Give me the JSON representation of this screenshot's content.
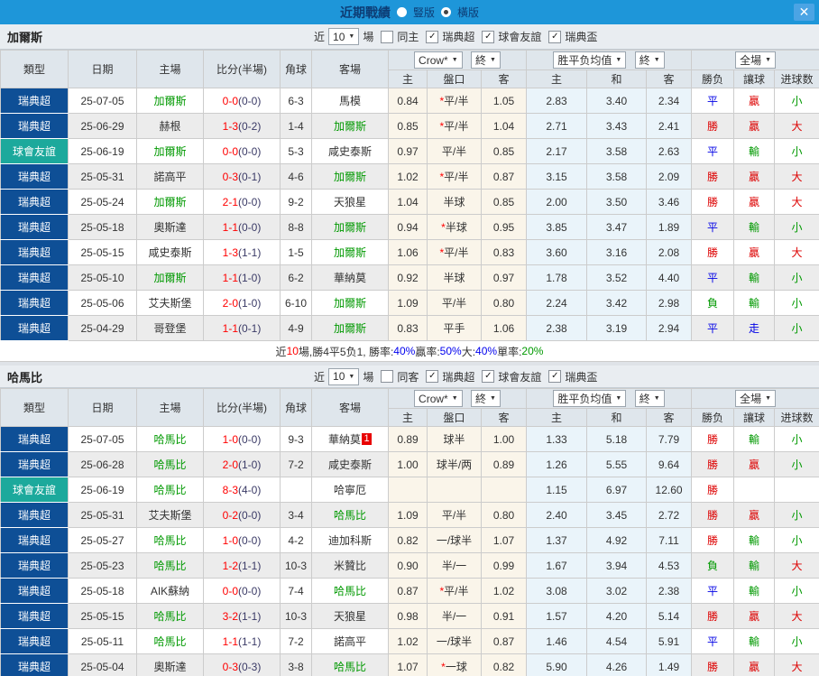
{
  "titlebar": {
    "title": "近期戰績",
    "layout_options": [
      {
        "label": "豎版",
        "selected": false
      },
      {
        "label": "橫版",
        "selected": true
      }
    ],
    "close_glyph": "✕"
  },
  "table_header": {
    "cols": [
      "類型",
      "日期",
      "主場",
      "比分(半場)",
      "角球",
      "客場"
    ],
    "odds_source": "Crow*",
    "final_label": "終",
    "avg_label": "胜平负均值",
    "scope_label": "全場",
    "sub": [
      "主",
      "盤口",
      "客",
      "主",
      "和",
      "客",
      "勝负",
      "讓球",
      "进球数"
    ]
  },
  "colors": {
    "topbar_blue": "#1e96d9",
    "league_navy": "#0e4f96",
    "friendly_teal": "#1ca99c",
    "focus_team_green": "#009900",
    "score_red": "#ff0000",
    "win_red": "#dd0000",
    "draw_blue": "#0000e6",
    "lose_green": "#009900"
  },
  "sections": [
    {
      "team": "加爾斯",
      "filter": {
        "prefix": "近",
        "count": "10",
        "suffix": "場",
        "same": {
          "label": "同主",
          "checked": false
        },
        "leagues": [
          {
            "label": "瑞典超",
            "checked": true
          },
          {
            "label": "球會友誼",
            "checked": true
          },
          {
            "label": "瑞典盃",
            "checked": true
          }
        ]
      },
      "rows": [
        {
          "lg": "瑞典超",
          "lgc": "n",
          "date": "25-07-05",
          "home": "加爾斯",
          "hf": true,
          "af": false,
          "score": "0-0",
          "half": "(0-0)",
          "cn": "6-3",
          "away": "馬模",
          "ab": "",
          "o1": "0.84",
          "hc": "*平/半",
          "o2": "1.05",
          "m1": "2.83",
          "m2": "3.40",
          "m3": "2.34",
          "r1": "平|b",
          "r2": "贏|r",
          "r3": "小|g"
        },
        {
          "lg": "瑞典超",
          "lgc": "n",
          "date": "25-06-29",
          "home": "赫根",
          "hf": false,
          "af": true,
          "score": "1-3",
          "half": "(0-2)",
          "cn": "1-4",
          "away": "加爾斯",
          "ab": "",
          "o1": "0.85",
          "hc": "*平/半",
          "o2": "1.04",
          "m1": "2.71",
          "m2": "3.43",
          "m3": "2.41",
          "r1": "勝|r",
          "r2": "贏|r",
          "r3": "大|r"
        },
        {
          "lg": "球會友誼",
          "lgc": "t",
          "date": "25-06-19",
          "home": "加爾斯",
          "hf": true,
          "af": false,
          "score": "0-0",
          "half": "(0-0)",
          "cn": "5-3",
          "away": "咸史泰斯",
          "ab": "",
          "o1": "0.97",
          "hc": "平/半",
          "o2": "0.85",
          "m1": "2.17",
          "m2": "3.58",
          "m3": "2.63",
          "r1": "平|b",
          "r2": "輸|g",
          "r3": "小|g"
        },
        {
          "lg": "瑞典超",
          "lgc": "n",
          "date": "25-05-31",
          "home": "諾高平",
          "hf": false,
          "af": true,
          "score": "0-3",
          "half": "(0-1)",
          "cn": "4-6",
          "away": "加爾斯",
          "ab": "",
          "o1": "1.02",
          "hc": "*平/半",
          "o2": "0.87",
          "m1": "3.15",
          "m2": "3.58",
          "m3": "2.09",
          "r1": "勝|r",
          "r2": "贏|r",
          "r3": "大|r"
        },
        {
          "lg": "瑞典超",
          "lgc": "n",
          "date": "25-05-24",
          "home": "加爾斯",
          "hf": true,
          "af": false,
          "score": "2-1",
          "half": "(0-0)",
          "cn": "9-2",
          "away": "天狼星",
          "ab": "",
          "o1": "1.04",
          "hc": "半球",
          "o2": "0.85",
          "m1": "2.00",
          "m2": "3.50",
          "m3": "3.46",
          "r1": "勝|r",
          "r2": "贏|r",
          "r3": "大|r"
        },
        {
          "lg": "瑞典超",
          "lgc": "n",
          "date": "25-05-18",
          "home": "奧斯達",
          "hf": false,
          "af": true,
          "score": "1-1",
          "half": "(0-0)",
          "cn": "8-8",
          "away": "加爾斯",
          "ab": "",
          "o1": "0.94",
          "hc": "*半球",
          "o2": "0.95",
          "m1": "3.85",
          "m2": "3.47",
          "m3": "1.89",
          "r1": "平|b",
          "r2": "輸|g",
          "r3": "小|g"
        },
        {
          "lg": "瑞典超",
          "lgc": "n",
          "date": "25-05-15",
          "home": "咸史泰斯",
          "hf": false,
          "af": true,
          "score": "1-3",
          "half": "(1-1)",
          "cn": "1-5",
          "away": "加爾斯",
          "ab": "",
          "o1": "1.06",
          "hc": "*平/半",
          "o2": "0.83",
          "m1": "3.60",
          "m2": "3.16",
          "m3": "2.08",
          "r1": "勝|r",
          "r2": "贏|r",
          "r3": "大|r"
        },
        {
          "lg": "瑞典超",
          "lgc": "n",
          "date": "25-05-10",
          "home": "加爾斯",
          "hf": true,
          "af": false,
          "score": "1-1",
          "half": "(1-0)",
          "cn": "6-2",
          "away": "華納莫",
          "ab": "",
          "o1": "0.92",
          "hc": "半球",
          "o2": "0.97",
          "m1": "1.78",
          "m2": "3.52",
          "m3": "4.40",
          "r1": "平|b",
          "r2": "輸|g",
          "r3": "小|g"
        },
        {
          "lg": "瑞典超",
          "lgc": "n",
          "date": "25-05-06",
          "home": "艾夫斯堡",
          "hf": false,
          "af": true,
          "score": "2-0",
          "half": "(1-0)",
          "cn": "6-10",
          "away": "加爾斯",
          "ab": "",
          "o1": "1.09",
          "hc": "平/半",
          "o2": "0.80",
          "m1": "2.24",
          "m2": "3.42",
          "m3": "2.98",
          "r1": "負|g",
          "r2": "輸|g",
          "r3": "小|g"
        },
        {
          "lg": "瑞典超",
          "lgc": "n",
          "date": "25-04-29",
          "home": "哥登堡",
          "hf": false,
          "af": true,
          "score": "1-1",
          "half": "(0-1)",
          "cn": "4-9",
          "away": "加爾斯",
          "ab": "",
          "o1": "0.83",
          "hc": "平手",
          "o2": "1.06",
          "m1": "2.38",
          "m2": "3.19",
          "m3": "2.94",
          "r1": "平|b",
          "r2": "走|b",
          "r3": "小|g"
        }
      ],
      "summary": [
        {
          "t": "近",
          "c": "d"
        },
        {
          "t": "10",
          "c": "r"
        },
        {
          "t": "場,勝4平5负1, 勝率:",
          "c": "d"
        },
        {
          "t": "40%",
          "c": "b"
        },
        {
          "t": " 贏率:",
          "c": "d"
        },
        {
          "t": "50%",
          "c": "b"
        },
        {
          "t": " 大:",
          "c": "d"
        },
        {
          "t": "40%",
          "c": "b"
        },
        {
          "t": " 單率:",
          "c": "d"
        },
        {
          "t": "20%",
          "c": "g"
        }
      ]
    },
    {
      "team": "哈馬比",
      "filter": {
        "prefix": "近",
        "count": "10",
        "suffix": "場",
        "same": {
          "label": "同客",
          "checked": false
        },
        "leagues": [
          {
            "label": "瑞典超",
            "checked": true
          },
          {
            "label": "球會友誼",
            "checked": true
          },
          {
            "label": "瑞典盃",
            "checked": true
          }
        ]
      },
      "rows": [
        {
          "lg": "瑞典超",
          "lgc": "n",
          "date": "25-07-05",
          "home": "哈馬比",
          "hf": true,
          "af": false,
          "score": "1-0",
          "half": "(0-0)",
          "cn": "9-3",
          "away": "華納莫",
          "ab": "1",
          "o1": "0.89",
          "hc": "球半",
          "o2": "1.00",
          "m1": "1.33",
          "m2": "5.18",
          "m3": "7.79",
          "r1": "勝|r",
          "r2": "輸|g",
          "r3": "小|g"
        },
        {
          "lg": "瑞典超",
          "lgc": "n",
          "date": "25-06-28",
          "home": "哈馬比",
          "hf": true,
          "af": false,
          "score": "2-0",
          "half": "(1-0)",
          "cn": "7-2",
          "away": "咸史泰斯",
          "ab": "",
          "o1": "1.00",
          "hc": "球半/两",
          "o2": "0.89",
          "m1": "1.26",
          "m2": "5.55",
          "m3": "9.64",
          "r1": "勝|r",
          "r2": "贏|r",
          "r3": "小|g"
        },
        {
          "lg": "球會友誼",
          "lgc": "t",
          "date": "25-06-19",
          "home": "哈馬比",
          "hf": true,
          "af": false,
          "score": "8-3",
          "half": "(4-0)",
          "cn": "",
          "away": "哈寧厄",
          "ab": "",
          "o1": "",
          "hc": "",
          "o2": "",
          "m1": "1.15",
          "m2": "6.97",
          "m3": "12.60",
          "r1": "勝|r",
          "r2": "",
          "r3": ""
        },
        {
          "lg": "瑞典超",
          "lgc": "n",
          "date": "25-05-31",
          "home": "艾夫斯堡",
          "hf": false,
          "af": true,
          "score": "0-2",
          "half": "(0-0)",
          "cn": "3-4",
          "away": "哈馬比",
          "ab": "",
          "o1": "1.09",
          "hc": "平/半",
          "o2": "0.80",
          "m1": "2.40",
          "m2": "3.45",
          "m3": "2.72",
          "r1": "勝|r",
          "r2": "贏|r",
          "r3": "小|g"
        },
        {
          "lg": "瑞典超",
          "lgc": "n",
          "date": "25-05-27",
          "home": "哈馬比",
          "hf": true,
          "af": false,
          "score": "1-0",
          "half": "(0-0)",
          "cn": "4-2",
          "away": "迪加科斯",
          "ab": "",
          "o1": "0.82",
          "hc": "一/球半",
          "o2": "1.07",
          "m1": "1.37",
          "m2": "4.92",
          "m3": "7.11",
          "r1": "勝|r",
          "r2": "輸|g",
          "r3": "小|g"
        },
        {
          "lg": "瑞典超",
          "lgc": "n",
          "date": "25-05-23",
          "home": "哈馬比",
          "hf": true,
          "af": false,
          "score": "1-2",
          "half": "(1-1)",
          "cn": "10-3",
          "away": "米贊比",
          "ab": "",
          "o1": "0.90",
          "hc": "半/一",
          "o2": "0.99",
          "m1": "1.67",
          "m2": "3.94",
          "m3": "4.53",
          "r1": "負|g",
          "r2": "輸|g",
          "r3": "大|r"
        },
        {
          "lg": "瑞典超",
          "lgc": "n",
          "date": "25-05-18",
          "home": "AIK蘇納",
          "hf": false,
          "af": true,
          "score": "0-0",
          "half": "(0-0)",
          "cn": "7-4",
          "away": "哈馬比",
          "ab": "",
          "o1": "0.87",
          "hc": "*平/半",
          "o2": "1.02",
          "m1": "3.08",
          "m2": "3.02",
          "m3": "2.38",
          "r1": "平|b",
          "r2": "輸|g",
          "r3": "小|g"
        },
        {
          "lg": "瑞典超",
          "lgc": "n",
          "date": "25-05-15",
          "home": "哈馬比",
          "hf": true,
          "af": false,
          "score": "3-2",
          "half": "(1-1)",
          "cn": "10-3",
          "away": "天狼星",
          "ab": "",
          "o1": "0.98",
          "hc": "半/一",
          "o2": "0.91",
          "m1": "1.57",
          "m2": "4.20",
          "m3": "5.14",
          "r1": "勝|r",
          "r2": "贏|r",
          "r3": "大|r"
        },
        {
          "lg": "瑞典超",
          "lgc": "n",
          "date": "25-05-11",
          "home": "哈馬比",
          "hf": true,
          "af": false,
          "score": "1-1",
          "half": "(1-1)",
          "cn": "7-2",
          "away": "諾高平",
          "ab": "",
          "o1": "1.02",
          "hc": "一/球半",
          "o2": "0.87",
          "m1": "1.46",
          "m2": "4.54",
          "m3": "5.91",
          "r1": "平|b",
          "r2": "輸|g",
          "r3": "小|g"
        },
        {
          "lg": "瑞典超",
          "lgc": "n",
          "date": "25-05-04",
          "home": "奧斯達",
          "hf": false,
          "af": true,
          "score": "0-3",
          "half": "(0-3)",
          "cn": "3-8",
          "away": "哈馬比",
          "ab": "",
          "o1": "1.07",
          "hc": "*一球",
          "o2": "0.82",
          "m1": "5.90",
          "m2": "4.26",
          "m3": "1.49",
          "r1": "勝|r",
          "r2": "贏|r",
          "r3": "大|r"
        }
      ]
    }
  ]
}
